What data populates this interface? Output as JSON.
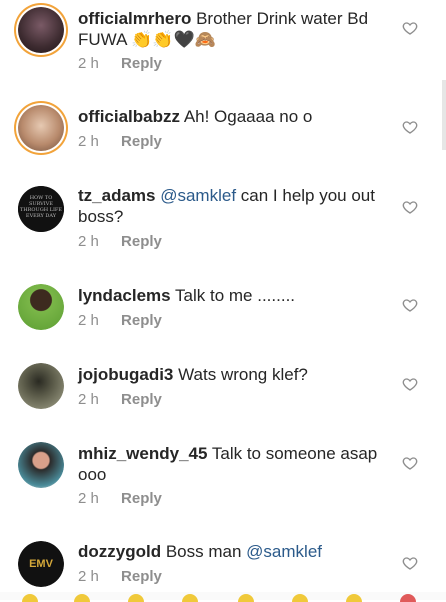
{
  "comments": [
    {
      "username": "officialmrhero",
      "text": "Brother Drink water Bd FUWA",
      "emoji": "👏👏🖤🙈",
      "time": "2 h",
      "reply": "Reply",
      "avatar_color": "#3d2b30"
    },
    {
      "username": "officialbabzz",
      "text": "Ah!  Ogaaaa no o",
      "time": "2 h",
      "reply": "Reply",
      "avatar_color": "#c9a88e"
    },
    {
      "username": "tz_adams",
      "mention": "@samklef",
      "text": "can I help you out boss?",
      "time": "2 h",
      "reply": "Reply",
      "avatar_color": "#111111"
    },
    {
      "username": "lyndaclems",
      "text": "Talk to me ........",
      "time": "2 h",
      "reply": "Reply",
      "avatar_color": "#6aa343"
    },
    {
      "username": "jojobugadi3",
      "text": "Wats wrong klef?",
      "time": "2 h",
      "reply": "Reply",
      "avatar_color": "#6b6b5a"
    },
    {
      "username": "mhiz_wendy_45",
      "text": "Talk to someone asap ooo",
      "time": "2 h",
      "reply": "Reply",
      "avatar_color": "#d8d8d8"
    },
    {
      "username": "dozzygold",
      "text": "Boss man",
      "mention": "@samklef",
      "time": "2 h",
      "reply": "Reply",
      "avatar_color": "#1a1a1a"
    }
  ],
  "tz_avatar_text": "HOW TO SURVIVE THROUGH LIFE EVERY DAY",
  "dozzy_avatar_text": "EMV"
}
